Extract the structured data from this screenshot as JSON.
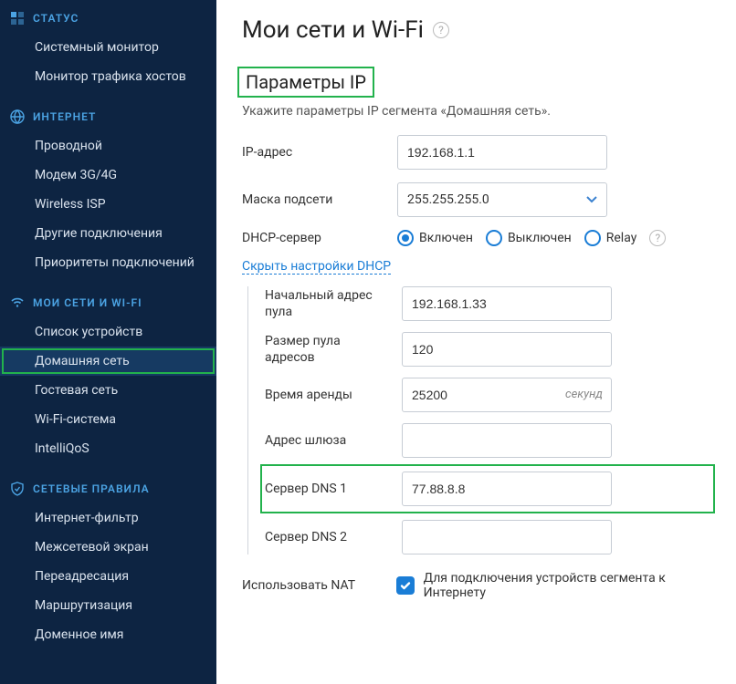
{
  "sidebar": {
    "groups": [
      {
        "icon": "dashboard-icon",
        "title": "СТАТУС",
        "items": [
          {
            "label": "Системный монитор"
          },
          {
            "label": "Монитор трафика хостов"
          }
        ]
      },
      {
        "icon": "globe-icon",
        "title": "ИНТЕРНЕТ",
        "items": [
          {
            "label": "Проводной"
          },
          {
            "label": "Модем 3G/4G"
          },
          {
            "label": "Wireless ISP"
          },
          {
            "label": "Другие подключения"
          },
          {
            "label": "Приоритеты подключений"
          }
        ]
      },
      {
        "icon": "wifi-icon",
        "title": "МОИ СЕТИ И WI-FI",
        "items": [
          {
            "label": "Список устройств"
          },
          {
            "label": "Домашняя сеть",
            "active": true,
            "highlight": true
          },
          {
            "label": "Гостевая сеть"
          },
          {
            "label": "Wi-Fi-система"
          },
          {
            "label": "IntelliQoS"
          }
        ]
      },
      {
        "icon": "shield-icon",
        "title": "СЕТЕВЫЕ ПРАВИЛА",
        "items": [
          {
            "label": "Интернет-фильтр"
          },
          {
            "label": "Межсетевой экран"
          },
          {
            "label": "Переадресация"
          },
          {
            "label": "Маршрутизация"
          },
          {
            "label": "Доменное имя"
          }
        ]
      }
    ]
  },
  "page": {
    "title": "Мои сети и Wi-Fi",
    "section_title": "Параметры IP",
    "section_desc": "Укажите параметры IP сегмента «Домашняя сеть».",
    "ip_label": "IP-адрес",
    "ip_value": "192.168.1.1",
    "mask_label": "Маска подсети",
    "mask_value": "255.255.255.0",
    "dhcp_label": "DHCP-сервер",
    "dhcp_options": {
      "on": "Включен",
      "off": "Выключен",
      "relay": "Relay"
    },
    "dhcp_selected": "on",
    "dhcp_toggle_link": "Скрыть настройки DHCP",
    "pool_start_label": "Начальный адрес пула",
    "pool_start_value": "192.168.1.33",
    "pool_size_label": "Размер пула адресов",
    "pool_size_value": "120",
    "lease_label": "Время аренды",
    "lease_value": "25200",
    "lease_suffix": "секунд",
    "gateway_label": "Адрес шлюза",
    "gateway_value": "",
    "dns1_label": "Сервер DNS 1",
    "dns1_value": "77.88.8.8",
    "dns2_label": "Сервер DNS 2",
    "dns2_value": "",
    "nat_label": "Использовать NAT",
    "nat_checked": true,
    "nat_desc": "Для подключения устройств сегмента к Интернету"
  }
}
